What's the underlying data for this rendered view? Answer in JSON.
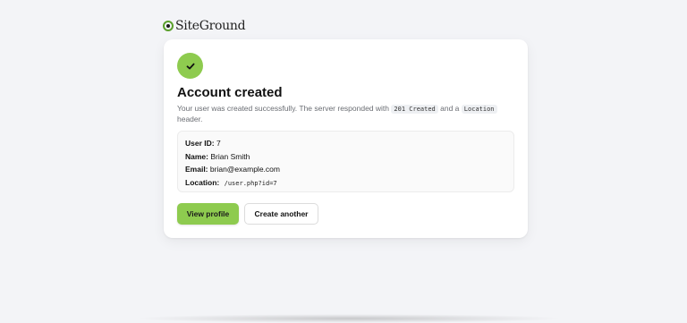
{
  "brand": {
    "name": "SiteGround",
    "accent_color": "#8ecb4f"
  },
  "card": {
    "status_icon": "check-icon",
    "title": "Account created",
    "description": {
      "part1": "Your user was created successfully. The server responded with",
      "code1": "201 Created",
      "part2": "and a",
      "code2": "Location",
      "part3": "header."
    },
    "details": {
      "user_id_label": "User ID:",
      "user_id_value": "7",
      "name_label": "Name:",
      "name_value": "Brian Smith",
      "email_label": "Email:",
      "email_value": "brian@example.com",
      "location_label": "Location:",
      "location_value": "/user.php?id=7"
    },
    "buttons": {
      "primary_label": "View profile",
      "secondary_label": "Create another"
    }
  }
}
